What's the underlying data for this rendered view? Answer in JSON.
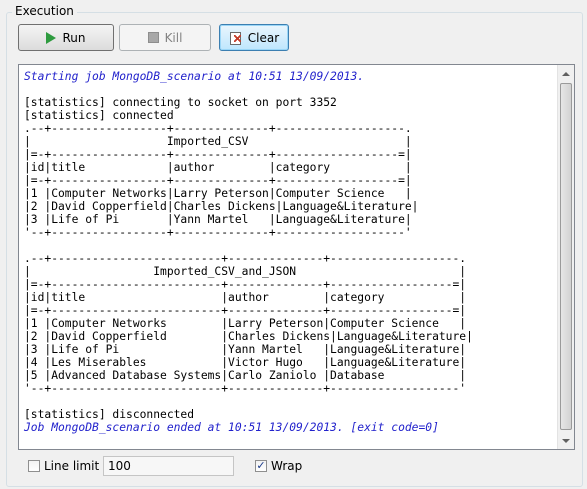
{
  "group": {
    "title": "Execution"
  },
  "toolbar": {
    "run_label": "Run",
    "kill_label": "Kill",
    "clear_label": "Clear",
    "run_icon": "play-icon",
    "kill_icon": "stop-icon",
    "clear_icon": "clear-console-icon"
  },
  "console": {
    "start_line": "Starting job MongoDB_scenario at 10:51 13/09/2013.",
    "output": "\n[statistics] connecting to socket on port 3352\n[statistics] connected\n.--+-----------------+--------------+-------------------.\n|                    Imported_CSV                       |\n|=-+-----------------+--------------+------------------=|\n|id|title            |author        |category           |\n|=-+-----------------+--------------+------------------=|\n|1 |Computer Networks|Larry Peterson|Computer Science   |\n|2 |David Copperfield|Charles Dickens|Language&Literature|\n|3 |Life of Pi       |Yann Martel   |Language&Literature|\n'--+-----------------+--------------+-------------------'\n\n.--+-------------------------+--------------+-------------------.\n|                  Imported_CSV_and_JSON                        |\n|=-+-------------------------+--------------+------------------=|\n|id|title                    |author        |category           |\n|=-+-------------------------+--------------+------------------=|\n|1 |Computer Networks        |Larry Peterson|Computer Science   |\n|2 |David Copperfield        |Charles Dickens|Language&Literature|\n|3 |Life of Pi               |Yann Martel   |Language&Literature|\n|4 |Les Miserables           |Victor Hugo   |Language&Literature|\n|5 |Advanced Database Systems|Carlo Zaniolo |Database           |\n'--+-------------------------+--------------+-------------------'\n\n[statistics] disconnected",
    "end_line": "Job MongoDB_scenario ended at 10:51 13/09/2013. [exit code=0]"
  },
  "footer": {
    "line_limit_label": "Line limit",
    "line_limit_checked": false,
    "line_limit_value": "100",
    "wrap_label": "Wrap",
    "wrap_checked": true
  },
  "colors": {
    "info_text": "#2222cc",
    "run_icon": "#2e9b3f"
  }
}
